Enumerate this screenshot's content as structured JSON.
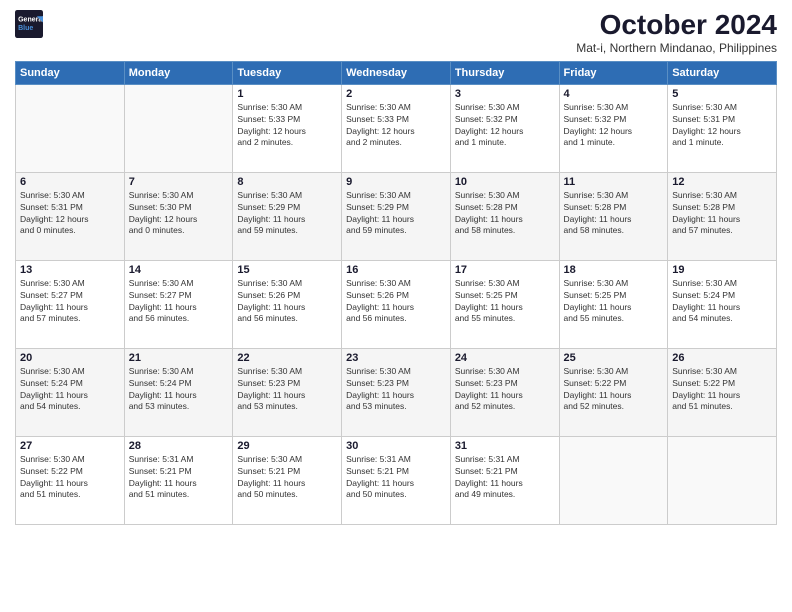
{
  "logo": {
    "line1": "General",
    "line2": "Blue"
  },
  "title": "October 2024",
  "subtitle": "Mat-i, Northern Mindanao, Philippines",
  "days_header": [
    "Sunday",
    "Monday",
    "Tuesday",
    "Wednesday",
    "Thursday",
    "Friday",
    "Saturday"
  ],
  "weeks": [
    [
      {
        "num": "",
        "info": ""
      },
      {
        "num": "",
        "info": ""
      },
      {
        "num": "1",
        "info": "Sunrise: 5:30 AM\nSunset: 5:33 PM\nDaylight: 12 hours\nand 2 minutes."
      },
      {
        "num": "2",
        "info": "Sunrise: 5:30 AM\nSunset: 5:33 PM\nDaylight: 12 hours\nand 2 minutes."
      },
      {
        "num": "3",
        "info": "Sunrise: 5:30 AM\nSunset: 5:32 PM\nDaylight: 12 hours\nand 1 minute."
      },
      {
        "num": "4",
        "info": "Sunrise: 5:30 AM\nSunset: 5:32 PM\nDaylight: 12 hours\nand 1 minute."
      },
      {
        "num": "5",
        "info": "Sunrise: 5:30 AM\nSunset: 5:31 PM\nDaylight: 12 hours\nand 1 minute."
      }
    ],
    [
      {
        "num": "6",
        "info": "Sunrise: 5:30 AM\nSunset: 5:31 PM\nDaylight: 12 hours\nand 0 minutes."
      },
      {
        "num": "7",
        "info": "Sunrise: 5:30 AM\nSunset: 5:30 PM\nDaylight: 12 hours\nand 0 minutes."
      },
      {
        "num": "8",
        "info": "Sunrise: 5:30 AM\nSunset: 5:29 PM\nDaylight: 11 hours\nand 59 minutes."
      },
      {
        "num": "9",
        "info": "Sunrise: 5:30 AM\nSunset: 5:29 PM\nDaylight: 11 hours\nand 59 minutes."
      },
      {
        "num": "10",
        "info": "Sunrise: 5:30 AM\nSunset: 5:28 PM\nDaylight: 11 hours\nand 58 minutes."
      },
      {
        "num": "11",
        "info": "Sunrise: 5:30 AM\nSunset: 5:28 PM\nDaylight: 11 hours\nand 58 minutes."
      },
      {
        "num": "12",
        "info": "Sunrise: 5:30 AM\nSunset: 5:28 PM\nDaylight: 11 hours\nand 57 minutes."
      }
    ],
    [
      {
        "num": "13",
        "info": "Sunrise: 5:30 AM\nSunset: 5:27 PM\nDaylight: 11 hours\nand 57 minutes."
      },
      {
        "num": "14",
        "info": "Sunrise: 5:30 AM\nSunset: 5:27 PM\nDaylight: 11 hours\nand 56 minutes."
      },
      {
        "num": "15",
        "info": "Sunrise: 5:30 AM\nSunset: 5:26 PM\nDaylight: 11 hours\nand 56 minutes."
      },
      {
        "num": "16",
        "info": "Sunrise: 5:30 AM\nSunset: 5:26 PM\nDaylight: 11 hours\nand 56 minutes."
      },
      {
        "num": "17",
        "info": "Sunrise: 5:30 AM\nSunset: 5:25 PM\nDaylight: 11 hours\nand 55 minutes."
      },
      {
        "num": "18",
        "info": "Sunrise: 5:30 AM\nSunset: 5:25 PM\nDaylight: 11 hours\nand 55 minutes."
      },
      {
        "num": "19",
        "info": "Sunrise: 5:30 AM\nSunset: 5:24 PM\nDaylight: 11 hours\nand 54 minutes."
      }
    ],
    [
      {
        "num": "20",
        "info": "Sunrise: 5:30 AM\nSunset: 5:24 PM\nDaylight: 11 hours\nand 54 minutes."
      },
      {
        "num": "21",
        "info": "Sunrise: 5:30 AM\nSunset: 5:24 PM\nDaylight: 11 hours\nand 53 minutes."
      },
      {
        "num": "22",
        "info": "Sunrise: 5:30 AM\nSunset: 5:23 PM\nDaylight: 11 hours\nand 53 minutes."
      },
      {
        "num": "23",
        "info": "Sunrise: 5:30 AM\nSunset: 5:23 PM\nDaylight: 11 hours\nand 53 minutes."
      },
      {
        "num": "24",
        "info": "Sunrise: 5:30 AM\nSunset: 5:23 PM\nDaylight: 11 hours\nand 52 minutes."
      },
      {
        "num": "25",
        "info": "Sunrise: 5:30 AM\nSunset: 5:22 PM\nDaylight: 11 hours\nand 52 minutes."
      },
      {
        "num": "26",
        "info": "Sunrise: 5:30 AM\nSunset: 5:22 PM\nDaylight: 11 hours\nand 51 minutes."
      }
    ],
    [
      {
        "num": "27",
        "info": "Sunrise: 5:30 AM\nSunset: 5:22 PM\nDaylight: 11 hours\nand 51 minutes."
      },
      {
        "num": "28",
        "info": "Sunrise: 5:31 AM\nSunset: 5:21 PM\nDaylight: 11 hours\nand 51 minutes."
      },
      {
        "num": "29",
        "info": "Sunrise: 5:30 AM\nSunset: 5:21 PM\nDaylight: 11 hours\nand 50 minutes."
      },
      {
        "num": "30",
        "info": "Sunrise: 5:31 AM\nSunset: 5:21 PM\nDaylight: 11 hours\nand 50 minutes."
      },
      {
        "num": "31",
        "info": "Sunrise: 5:31 AM\nSunset: 5:21 PM\nDaylight: 11 hours\nand 49 minutes."
      },
      {
        "num": "",
        "info": ""
      },
      {
        "num": "",
        "info": ""
      }
    ]
  ]
}
